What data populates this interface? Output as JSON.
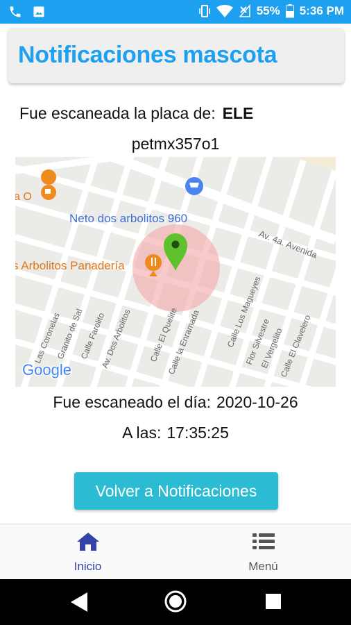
{
  "status": {
    "battery": "55%",
    "time": "5:36 PM",
    "icons": [
      "phone-icon",
      "image-icon",
      "vibrate-icon",
      "wifi-icon",
      "no-signal-icon",
      "battery-icon"
    ]
  },
  "header": {
    "title": "Notificaciones mascota"
  },
  "scan": {
    "plate_label": "Fue escaneada la placa de:",
    "plate_value": "ELE",
    "pet_id": "petmx357o1"
  },
  "map": {
    "store_label": "Neto dos arbolitos 960",
    "bakery_label": "s Arbolitos Panadería",
    "left_poi_label": "a O",
    "avenue_label": "Av. 4a. Avenida",
    "streets": [
      "Las Coronelas",
      "Granito de Sal",
      "Calle Farolito",
      "Av. Dos Arbolitos",
      "Calle El Quelite",
      "Calle la Enramada",
      "Calle Los Magueyes",
      "Flor Silvestre",
      "El Vergelito",
      "Calle El Clavelero"
    ],
    "attribution": "Google",
    "colors": {
      "pin": "#5fc12e",
      "radius": "#f4a6a8",
      "store": "#4a84f0",
      "food": "#ef8a1f"
    }
  },
  "date": {
    "label": "Fue escaneado el día:",
    "value": "2020-10-26"
  },
  "time": {
    "label": "A las:",
    "value": "17:35:25"
  },
  "button": {
    "label": "Volver a Notificaciones"
  },
  "tabs": [
    {
      "label": "Inicio",
      "icon": "home-icon"
    },
    {
      "label": "Menú",
      "icon": "menu-icon"
    }
  ],
  "colors": {
    "accent": "#1ea0f0",
    "button": "#2bbbd2",
    "active_tab": "#3343a8"
  }
}
